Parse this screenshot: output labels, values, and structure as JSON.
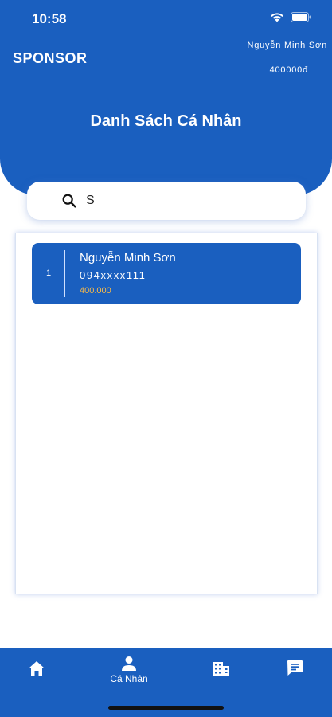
{
  "status_bar": {
    "time": "10:58"
  },
  "app_bar": {
    "title": "SPONSOR",
    "user_name": "Nguyễn Minh Sơn",
    "balance": "400000đ"
  },
  "page": {
    "title": "Danh Sách Cá Nhân"
  },
  "search": {
    "value": "S",
    "placeholder": ""
  },
  "list": {
    "items": [
      {
        "index": "1",
        "name": "Nguyễn Minh Sơn",
        "phone": "094xxxx111",
        "amount": "400.000"
      }
    ]
  },
  "bottom_nav": {
    "items": [
      {
        "icon": "home-icon",
        "label": ""
      },
      {
        "icon": "person-icon",
        "label": "Cá Nhân",
        "active": true
      },
      {
        "icon": "building-icon",
        "label": ""
      },
      {
        "icon": "chat-icon",
        "label": ""
      }
    ]
  },
  "colors": {
    "primary": "#1a5fbf",
    "amount": "#f5b84a",
    "background": "#ffffff"
  }
}
